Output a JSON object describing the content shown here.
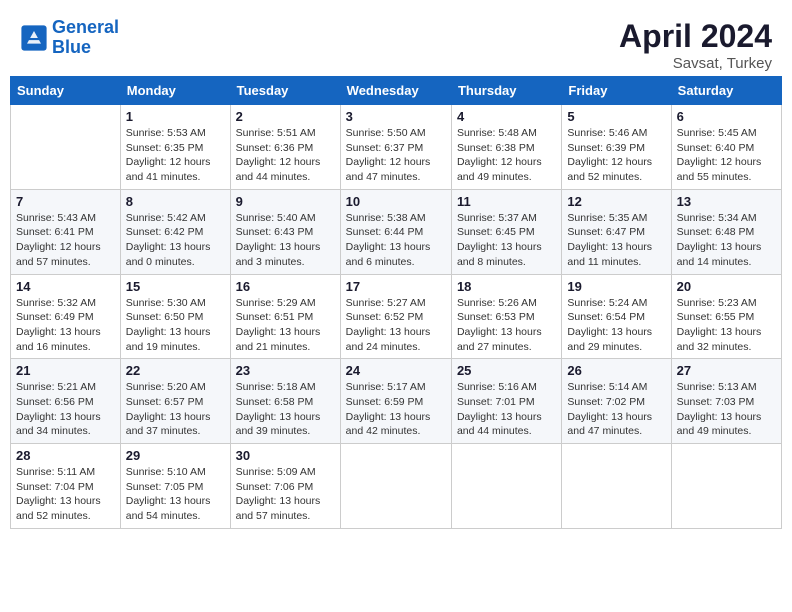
{
  "header": {
    "logo_line1": "General",
    "logo_line2": "Blue",
    "title": "April 2024",
    "subtitle": "Savsat, Turkey"
  },
  "days_of_week": [
    "Sunday",
    "Monday",
    "Tuesday",
    "Wednesday",
    "Thursday",
    "Friday",
    "Saturday"
  ],
  "weeks": [
    [
      {
        "day": "",
        "info": ""
      },
      {
        "day": "1",
        "info": "Sunrise: 5:53 AM\nSunset: 6:35 PM\nDaylight: 12 hours\nand 41 minutes."
      },
      {
        "day": "2",
        "info": "Sunrise: 5:51 AM\nSunset: 6:36 PM\nDaylight: 12 hours\nand 44 minutes."
      },
      {
        "day": "3",
        "info": "Sunrise: 5:50 AM\nSunset: 6:37 PM\nDaylight: 12 hours\nand 47 minutes."
      },
      {
        "day": "4",
        "info": "Sunrise: 5:48 AM\nSunset: 6:38 PM\nDaylight: 12 hours\nand 49 minutes."
      },
      {
        "day": "5",
        "info": "Sunrise: 5:46 AM\nSunset: 6:39 PM\nDaylight: 12 hours\nand 52 minutes."
      },
      {
        "day": "6",
        "info": "Sunrise: 5:45 AM\nSunset: 6:40 PM\nDaylight: 12 hours\nand 55 minutes."
      }
    ],
    [
      {
        "day": "7",
        "info": "Sunrise: 5:43 AM\nSunset: 6:41 PM\nDaylight: 12 hours\nand 57 minutes."
      },
      {
        "day": "8",
        "info": "Sunrise: 5:42 AM\nSunset: 6:42 PM\nDaylight: 13 hours\nand 0 minutes."
      },
      {
        "day": "9",
        "info": "Sunrise: 5:40 AM\nSunset: 6:43 PM\nDaylight: 13 hours\nand 3 minutes."
      },
      {
        "day": "10",
        "info": "Sunrise: 5:38 AM\nSunset: 6:44 PM\nDaylight: 13 hours\nand 6 minutes."
      },
      {
        "day": "11",
        "info": "Sunrise: 5:37 AM\nSunset: 6:45 PM\nDaylight: 13 hours\nand 8 minutes."
      },
      {
        "day": "12",
        "info": "Sunrise: 5:35 AM\nSunset: 6:47 PM\nDaylight: 13 hours\nand 11 minutes."
      },
      {
        "day": "13",
        "info": "Sunrise: 5:34 AM\nSunset: 6:48 PM\nDaylight: 13 hours\nand 14 minutes."
      }
    ],
    [
      {
        "day": "14",
        "info": "Sunrise: 5:32 AM\nSunset: 6:49 PM\nDaylight: 13 hours\nand 16 minutes."
      },
      {
        "day": "15",
        "info": "Sunrise: 5:30 AM\nSunset: 6:50 PM\nDaylight: 13 hours\nand 19 minutes."
      },
      {
        "day": "16",
        "info": "Sunrise: 5:29 AM\nSunset: 6:51 PM\nDaylight: 13 hours\nand 21 minutes."
      },
      {
        "day": "17",
        "info": "Sunrise: 5:27 AM\nSunset: 6:52 PM\nDaylight: 13 hours\nand 24 minutes."
      },
      {
        "day": "18",
        "info": "Sunrise: 5:26 AM\nSunset: 6:53 PM\nDaylight: 13 hours\nand 27 minutes."
      },
      {
        "day": "19",
        "info": "Sunrise: 5:24 AM\nSunset: 6:54 PM\nDaylight: 13 hours\nand 29 minutes."
      },
      {
        "day": "20",
        "info": "Sunrise: 5:23 AM\nSunset: 6:55 PM\nDaylight: 13 hours\nand 32 minutes."
      }
    ],
    [
      {
        "day": "21",
        "info": "Sunrise: 5:21 AM\nSunset: 6:56 PM\nDaylight: 13 hours\nand 34 minutes."
      },
      {
        "day": "22",
        "info": "Sunrise: 5:20 AM\nSunset: 6:57 PM\nDaylight: 13 hours\nand 37 minutes."
      },
      {
        "day": "23",
        "info": "Sunrise: 5:18 AM\nSunset: 6:58 PM\nDaylight: 13 hours\nand 39 minutes."
      },
      {
        "day": "24",
        "info": "Sunrise: 5:17 AM\nSunset: 6:59 PM\nDaylight: 13 hours\nand 42 minutes."
      },
      {
        "day": "25",
        "info": "Sunrise: 5:16 AM\nSunset: 7:01 PM\nDaylight: 13 hours\nand 44 minutes."
      },
      {
        "day": "26",
        "info": "Sunrise: 5:14 AM\nSunset: 7:02 PM\nDaylight: 13 hours\nand 47 minutes."
      },
      {
        "day": "27",
        "info": "Sunrise: 5:13 AM\nSunset: 7:03 PM\nDaylight: 13 hours\nand 49 minutes."
      }
    ],
    [
      {
        "day": "28",
        "info": "Sunrise: 5:11 AM\nSunset: 7:04 PM\nDaylight: 13 hours\nand 52 minutes."
      },
      {
        "day": "29",
        "info": "Sunrise: 5:10 AM\nSunset: 7:05 PM\nDaylight: 13 hours\nand 54 minutes."
      },
      {
        "day": "30",
        "info": "Sunrise: 5:09 AM\nSunset: 7:06 PM\nDaylight: 13 hours\nand 57 minutes."
      },
      {
        "day": "",
        "info": ""
      },
      {
        "day": "",
        "info": ""
      },
      {
        "day": "",
        "info": ""
      },
      {
        "day": "",
        "info": ""
      }
    ]
  ]
}
